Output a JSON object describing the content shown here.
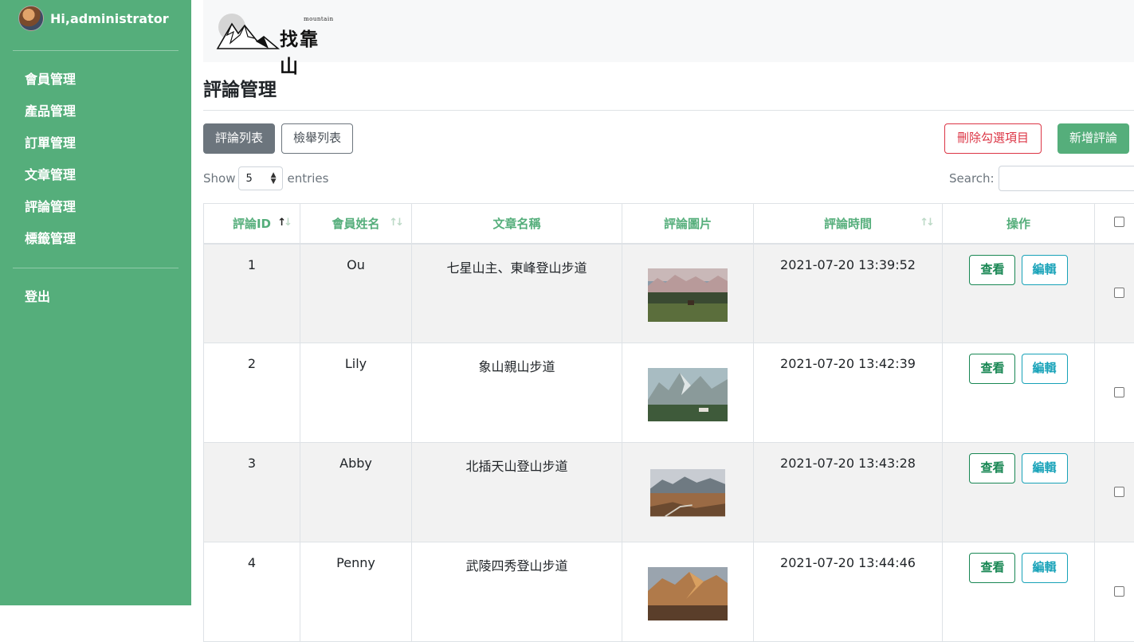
{
  "sidebar": {
    "user_greeting": "Hi,administrator",
    "items": [
      {
        "label": "會員管理"
      },
      {
        "label": "產品管理"
      },
      {
        "label": "訂單管理"
      },
      {
        "label": "文章管理"
      },
      {
        "label": "評論管理"
      },
      {
        "label": "標籤管理"
      }
    ],
    "logout_label": "登出"
  },
  "header": {
    "logo_small": "mountain",
    "logo_main": "找靠山"
  },
  "page": {
    "title": "評論管理",
    "tabs": {
      "active": "評論列表",
      "other": "檢舉列表"
    },
    "delete_label": "刪除勾選項目",
    "add_label": "新增評論",
    "show_label": "Show",
    "entries_label": "entries",
    "page_length": "5",
    "search_label": "Search:"
  },
  "table": {
    "headers": [
      "評論ID",
      "會員姓名",
      "文章名稱",
      "評論圖片",
      "評論時間",
      "操作"
    ],
    "view_label": "查看",
    "edit_label": "編輯",
    "rows": [
      {
        "id": "1",
        "member": "Ou",
        "article": "七星山主、東峰登山步道",
        "time": "2021-07-20 13:39:52"
      },
      {
        "id": "2",
        "member": "Lily",
        "article": "象山親山步道",
        "time": "2021-07-20 13:42:39"
      },
      {
        "id": "3",
        "member": "Abby",
        "article": "北插天山登山步道",
        "time": "2021-07-20 13:43:28"
      },
      {
        "id": "4",
        "member": "Penny",
        "article": "武陵四秀登山步道",
        "time": "2021-07-20 13:44:46"
      }
    ]
  },
  "colors": {
    "brand_green": "#55ae7b",
    "danger": "#dc3545",
    "info": "#17a2b8",
    "success": "#198754"
  }
}
